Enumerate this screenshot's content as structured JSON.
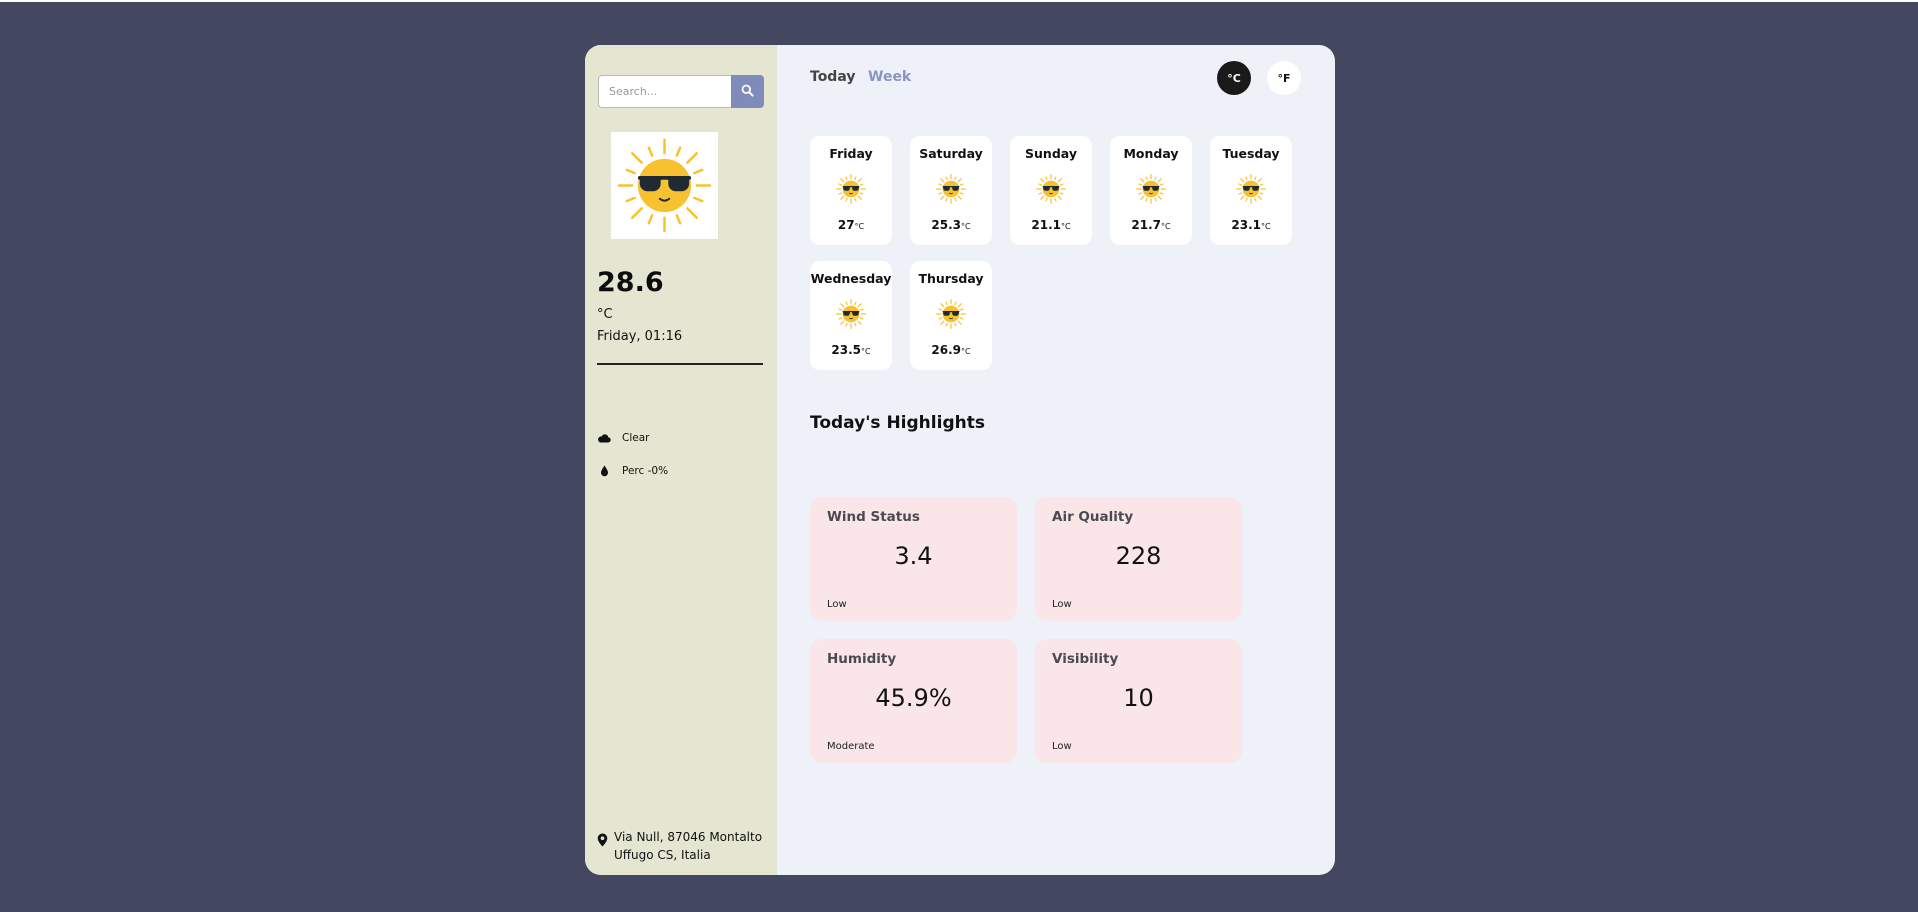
{
  "search": {
    "placeholder": "Search..."
  },
  "current": {
    "temperature": "28.6",
    "unit": "°C",
    "datetime": "Friday, 01:16",
    "condition": "Clear",
    "precipitation": "Perc -0%",
    "location": "Via Null, 87046 Montalto Uffugo CS, Italia"
  },
  "tabs": {
    "today": "Today",
    "week": "Week"
  },
  "units": {
    "celsius": "°C",
    "fahrenheit": "°F"
  },
  "forecast": [
    {
      "day": "Friday",
      "temp": "27",
      "unit": "°C"
    },
    {
      "day": "Saturday",
      "temp": "25.3",
      "unit": "°C"
    },
    {
      "day": "Sunday",
      "temp": "21.1",
      "unit": "°C"
    },
    {
      "day": "Monday",
      "temp": "21.7",
      "unit": "°C"
    },
    {
      "day": "Tuesday",
      "temp": "23.1",
      "unit": "°C"
    },
    {
      "day": "Wednesday",
      "temp": "23.5",
      "unit": "°C"
    },
    {
      "day": "Thursday",
      "temp": "26.9",
      "unit": "°C"
    }
  ],
  "highlights": {
    "title": "Today's Highlights",
    "cards": [
      {
        "title": "Wind Status",
        "value": "3.4",
        "status": "Low"
      },
      {
        "title": "Air Quality",
        "value": "228",
        "status": "Low"
      },
      {
        "title": "Humidity",
        "value": "45.9%",
        "status": "Moderate"
      },
      {
        "title": "Visibility",
        "value": "10",
        "status": "Low"
      }
    ]
  },
  "icons": {
    "search": "search-icon",
    "weather": "sun-with-sunglasses-icon",
    "condition": "cloud-icon",
    "precipitation": "droplet-icon",
    "location": "map-pin-icon"
  },
  "colors": {
    "background": "#434760",
    "sidebar": "#e4e6d1",
    "main": "#eef1f7",
    "accent": "#7f8bb8",
    "highlight_card": "#fae6e8",
    "sun": "#f7c12f"
  }
}
